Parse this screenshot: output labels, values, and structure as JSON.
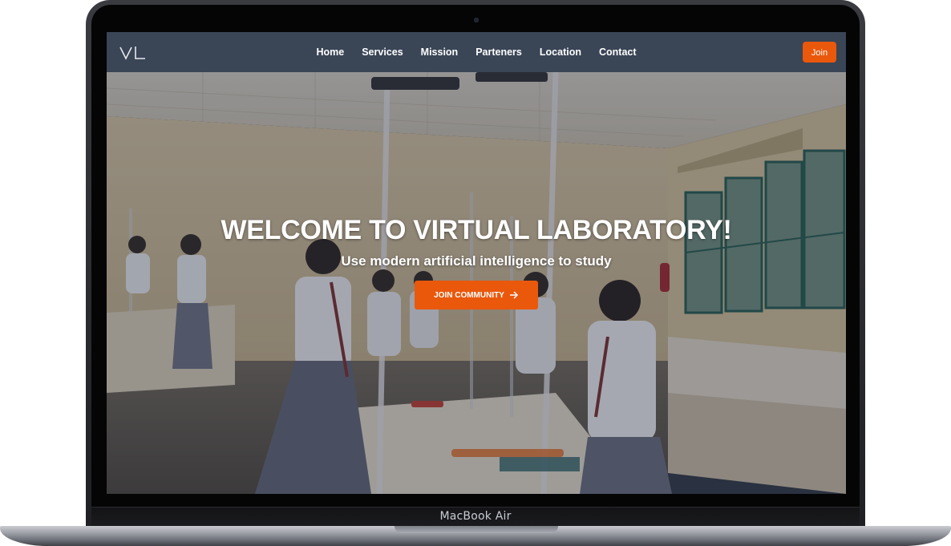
{
  "device": {
    "label": "MacBook Air"
  },
  "nav": {
    "logo_text": "VL",
    "links": [
      "Home",
      "Services",
      "Mission",
      "Parteners",
      "Location",
      "Contact"
    ],
    "join_label": "Join"
  },
  "hero": {
    "title": "WELCOME TO VIRTUAL LABORATORY!",
    "subtitle": "Use modern artificial intelligence to study",
    "cta_label": "JOIN COMMUNITY",
    "cta_icon": "arrow-right-icon",
    "background": "classroom-laboratory-photo"
  },
  "colors": {
    "navbar": "#3a4556",
    "accent": "#ea580c",
    "text": "#ffffff"
  }
}
